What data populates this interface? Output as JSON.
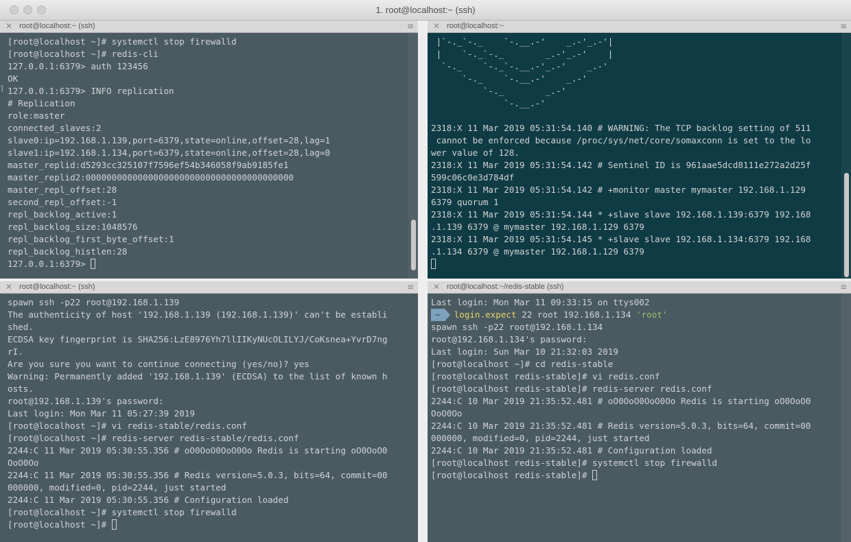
{
  "window": {
    "title": "1. root@localhost:~ (ssh)"
  },
  "colors": {
    "pane_bg": "#4a5a61",
    "pane_bg_dark": "#0f3b44",
    "text": "#d0d4d6",
    "prompt_badge": "#7ea2bd",
    "command": "#e6d267",
    "string": "#9fc06f"
  },
  "icons": {
    "close": "close-icon",
    "menu": "hamburger-menu-icon"
  },
  "panes": {
    "top_left": {
      "title": "root@localhost:~ (ssh)",
      "text": "[root@localhost ~]# systemctl stop firewalld\n[root@localhost ~]# redis-cli\n127.0.0.1:6379> auth 123456\nOK\n127.0.0.1:6379> INFO replication\n# Replication\nrole:master\nconnected_slaves:2\nslave0:ip=192.168.1.139,port=6379,state=online,offset=28,lag=1\nslave1:ip=192.168.1.134,port=6379,state=online,offset=28,lag=0\nmaster_replid:d5293cc325107f7596ef54b346058f9ab9185fe1\nmaster_replid2:0000000000000000000000000000000000000000\nmaster_repl_offset:28\nsecond_repl_offset:-1\nrepl_backlog_active:1\nrepl_backlog_size:1048576\nrepl_backlog_first_byte_offset:1\nrepl_backlog_histlen:28\n127.0.0.1:6379> "
    },
    "top_right": {
      "title": "root@localhost:~",
      "text": " |`-._`-._    `-.__.-'    _.-'_.-'|\n |    `-._`-._        _.-'_.-'    |\n  `-._    `-._`-.__.-'_.-'    _.-'\n      `-._    `-.__.-'    _.-'\n          `-._        _.-'\n              `-.__.-'\n\n2318:X 11 Mar 2019 05:31:54.140 # WARNING: The TCP backlog setting of 511\n cannot be enforced because /proc/sys/net/core/somaxconn is set to the lo\nwer value of 128.\n2318:X 11 Mar 2019 05:31:54.142 # Sentinel ID is 961aae5dcd8111e272a2d25f\n599c06c0e3d784df\n2318:X 11 Mar 2019 05:31:54.142 # +monitor master mymaster 192.168.1.129\n6379 quorum 1\n2318:X 11 Mar 2019 05:31:54.144 * +slave slave 192.168.1.139:6379 192.168\n.1.139 6379 @ mymaster 192.168.1.129 6379\n2318:X 11 Mar 2019 05:31:54.145 * +slave slave 192.168.1.134:6379 192.168\n.1.134 6379 @ mymaster 192.168.1.129 6379\n"
    },
    "bottom_left": {
      "title": "root@localhost:~ (ssh)",
      "text": "spawn ssh -p22 root@192.168.1.139\nThe authenticity of host '192.168.1.139 (192.168.1.139)' can't be establi\nshed.\nECDSA key fingerprint is SHA256:LzE8976Yh7llIIKyNUcOLILYJ/CoKsnea+YvrD7ng\nrI.\nAre you sure you want to continue connecting (yes/no)? yes\nWarning: Permanently added '192.168.1.139' (ECDSA) to the list of known h\nosts.\nroot@192.168.1.139's password:\nLast login: Mon Mar 11 05:27:39 2019\n[root@localhost ~]# vi redis-stable/redis.conf\n[root@localhost ~]# redis-server redis-stable/redis.conf\n2244:C 11 Mar 2019 05:30:55.356 # oO0OoO0OoO0Oo Redis is starting oO0OoO0\nOoO0Oo\n2244:C 11 Mar 2019 05:30:55.356 # Redis version=5.0.3, bits=64, commit=00\n000000, modified=0, pid=2244, just started\n2244:C 11 Mar 2019 05:30:55.356 # Configuration loaded\n[root@localhost ~]# systemctl stop firewalld\n[root@localhost ~]# "
    },
    "bottom_right": {
      "title": "root@localhost:~/redis-stable (ssh)",
      "line1": "Last login: Mon Mar 11 09:33:15 on ttys002",
      "prompt_badge": "~",
      "command": "login.expect",
      "args": " 22 root 192.168.1.134 ",
      "string_arg": "'root'",
      "text": "spawn ssh -p22 root@192.168.1.134\nroot@192.168.1.134's password:\nLast login: Sun Mar 10 21:32:03 2019\n[root@localhost ~]# cd redis-stable\n[root@localhost redis-stable]# vi redis.conf\n[root@localhost redis-stable]# redis-server redis.conf\n2244:C 10 Mar 2019 21:35:52.481 # oO0OoO0OoO0Oo Redis is starting oO0OoO0\nOoO0Oo\n2244:C 10 Mar 2019 21:35:52.481 # Redis version=5.0.3, bits=64, commit=00\n000000, modified=0, pid=2244, just started\n2244:C 10 Mar 2019 21:35:52.481 # Configuration loaded\n[root@localhost redis-stable]# systemctl stop firewalld\n[root@localhost redis-stable]# "
    }
  }
}
